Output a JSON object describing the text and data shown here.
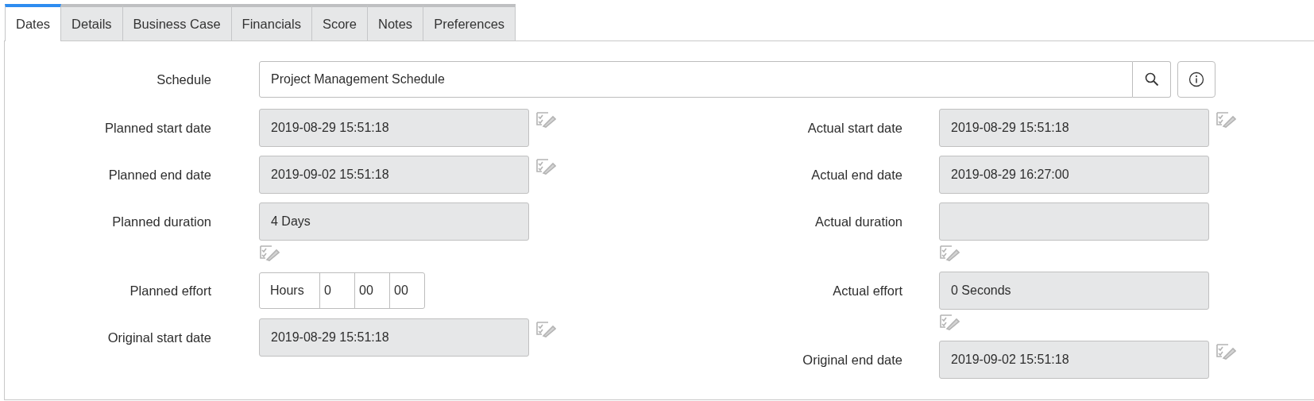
{
  "tabs": [
    {
      "label": "Dates",
      "selected": true
    },
    {
      "label": "Details",
      "selected": false
    },
    {
      "label": "Business Case",
      "selected": false
    },
    {
      "label": "Financials",
      "selected": false
    },
    {
      "label": "Score",
      "selected": false
    },
    {
      "label": "Notes",
      "selected": false
    },
    {
      "label": "Preferences",
      "selected": false
    }
  ],
  "schedule": {
    "label": "Schedule",
    "value": "Project Management Schedule"
  },
  "left_fields": [
    {
      "label": "Planned start date",
      "kind": "readonly",
      "value": "2019-08-29 15:51:18",
      "edit_icon": true,
      "edit_icon_below": false
    },
    {
      "label": "Planned end date",
      "kind": "readonly",
      "value": "2019-09-02 15:51:18",
      "edit_icon": true,
      "edit_icon_below": false
    },
    {
      "label": "Planned duration",
      "kind": "readonly",
      "value": "4 Days",
      "edit_icon": true,
      "edit_icon_below": true
    },
    {
      "label": "Planned effort",
      "kind": "duration",
      "unit": "Hours",
      "parts": [
        "0",
        "00",
        "00"
      ],
      "edit_icon": false
    },
    {
      "label": "Original start date",
      "kind": "readonly",
      "value": "2019-08-29 15:51:18",
      "edit_icon": true,
      "edit_icon_below": false
    }
  ],
  "right_fields": [
    {
      "label": "Actual start date",
      "kind": "readonly",
      "value": "2019-08-29 15:51:18",
      "edit_icon": true,
      "edit_icon_below": false
    },
    {
      "label": "Actual end date",
      "kind": "readonly",
      "value": "2019-08-29 16:27:00",
      "edit_icon": false
    },
    {
      "label": "Actual duration",
      "kind": "readonly",
      "edit_icon": true,
      "edit_icon_below": true
    },
    {
      "label": "Actual effort",
      "kind": "readonly",
      "value": "0 Seconds",
      "edit_icon": true,
      "edit_icon_below": true
    },
    {
      "label": "Original end date",
      "kind": "readonly",
      "value": "2019-09-02 15:51:18",
      "edit_icon": true,
      "edit_icon_below": false
    }
  ]
}
